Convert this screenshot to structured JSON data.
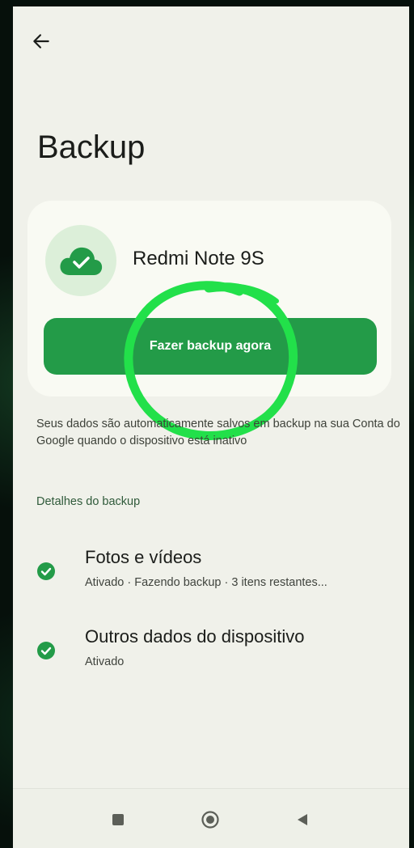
{
  "header": {
    "title": "Backup"
  },
  "device": {
    "name": "Redmi Note 9S"
  },
  "actions": {
    "backup_now_label": "Fazer backup agora"
  },
  "description": "Seus dados são automaticamente salvos em backup na sua Conta do Google quando o dispositivo está inativo",
  "details": {
    "header": "Detalhes do backup",
    "items": [
      {
        "title": "Fotos e vídeos",
        "subtitle": "Ativado · Fazendo backup · 3 itens restantes..."
      },
      {
        "title": "Outros dados do dispositivo",
        "subtitle": "Ativado"
      }
    ]
  },
  "icons": {
    "back": "arrow-left-icon",
    "device": "cloud-check-icon",
    "status": "check-circle-icon",
    "nav_recents": "square-icon",
    "nav_home": "circle-icon",
    "nav_back": "triangle-back-icon"
  },
  "colors": {
    "accent": "#239b48",
    "highlight": "#22e04a",
    "background": "#f0f1ea",
    "card": "#f9faf3"
  }
}
